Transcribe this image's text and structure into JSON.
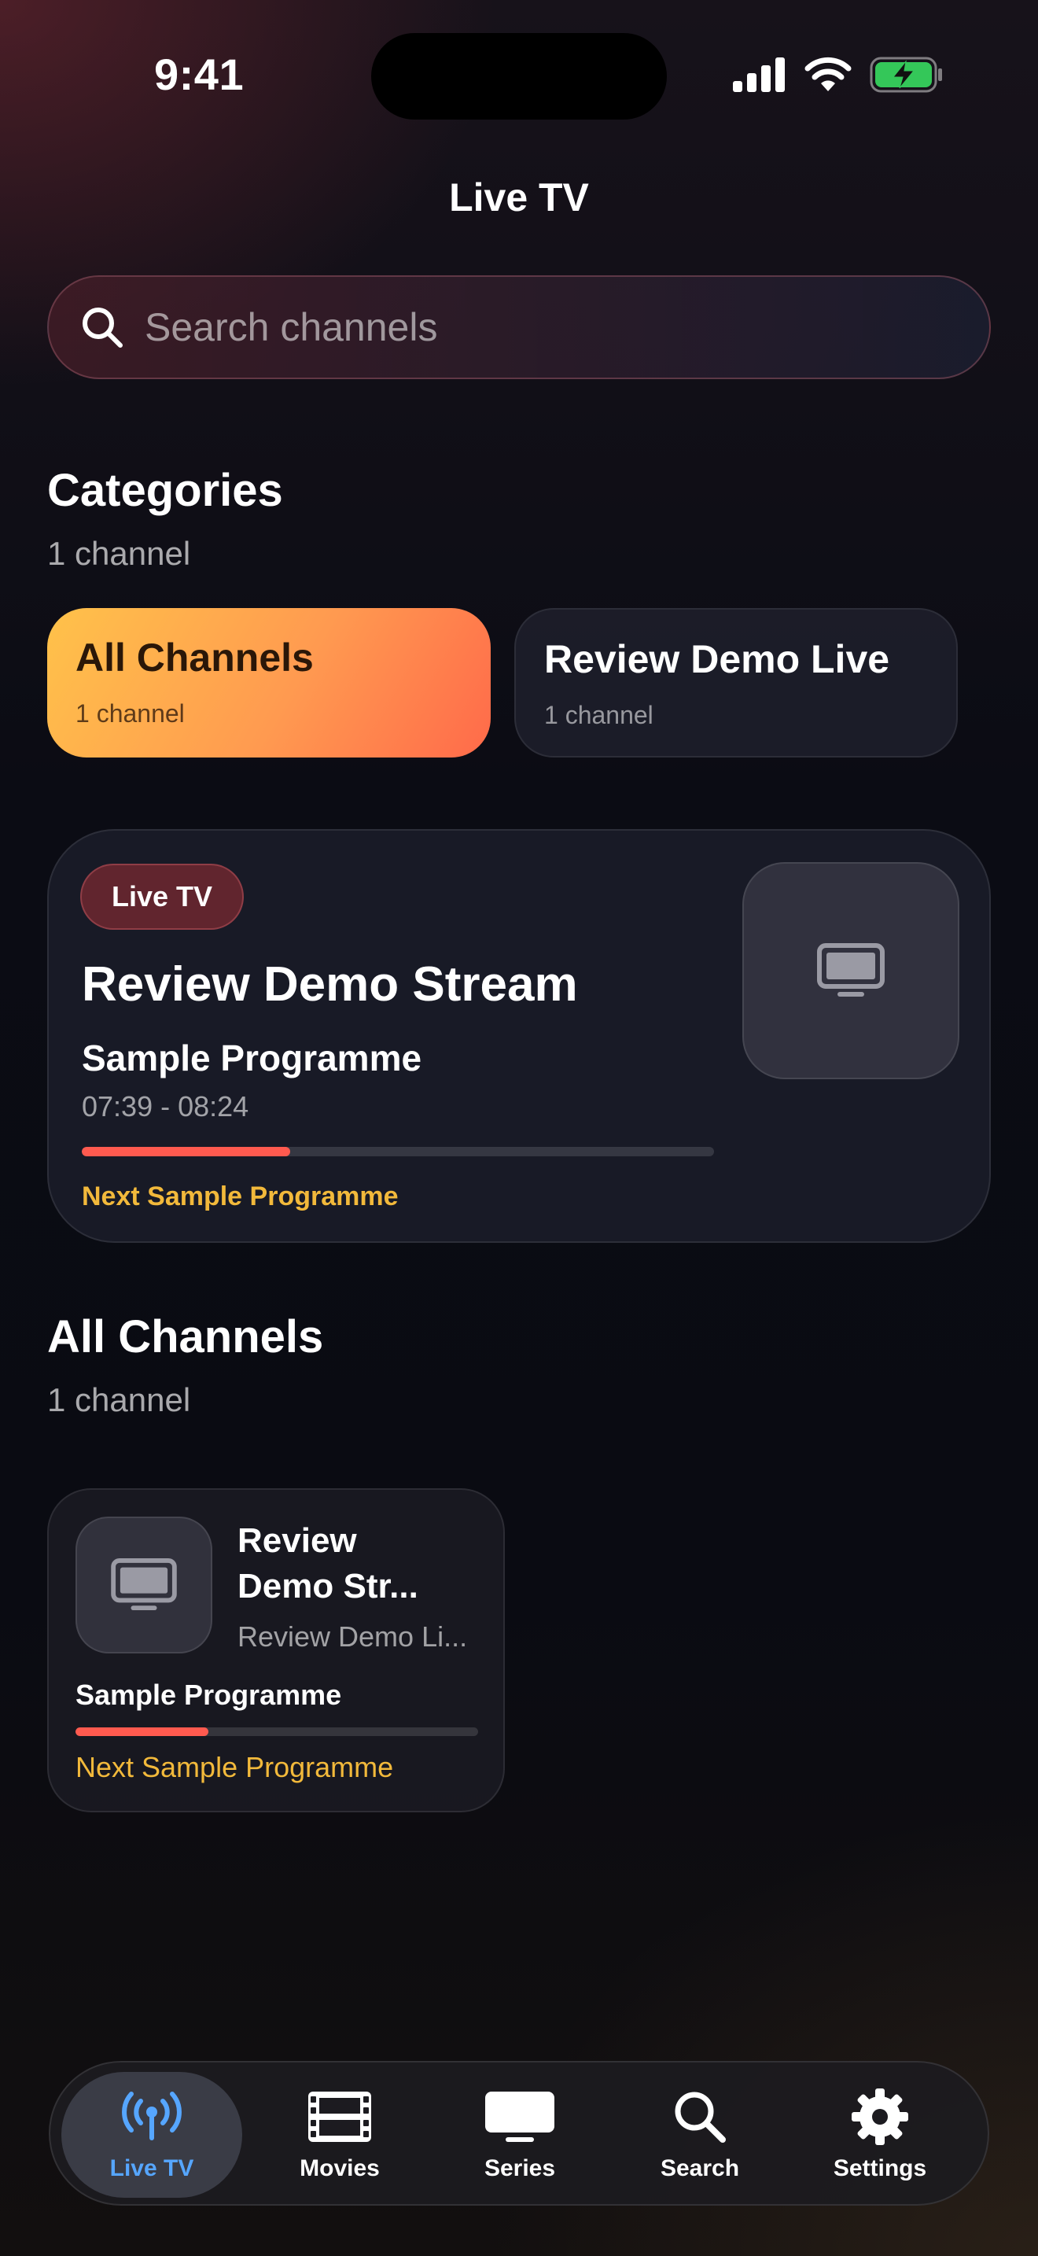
{
  "status_bar": {
    "time": "9:41",
    "icons": [
      "cellular-signal-icon",
      "wifi-icon",
      "battery-charging-icon"
    ]
  },
  "header": {
    "title": "Live TV"
  },
  "search": {
    "placeholder": "Search channels",
    "value": ""
  },
  "categories": {
    "title": "Categories",
    "subtitle": "1 channel",
    "items": [
      {
        "label": "All Channels",
        "count": "1 channel",
        "selected": true
      },
      {
        "label": "Review Demo Live",
        "count": "1 channel",
        "selected": false
      }
    ]
  },
  "featured": {
    "badge": "Live TV",
    "channel_name": "Review Demo Stream",
    "programme": "Sample Programme",
    "time_range": "07:39 - 08:24",
    "progress": 0.33,
    "next": "Next Sample Programme",
    "thumbnail_icon": "tv-icon"
  },
  "all_channels": {
    "title": "All Channels",
    "subtitle": "1 channel",
    "items": [
      {
        "name": "Review\nDemo Str...",
        "category": "Review Demo Li...",
        "programme": "Sample Programme",
        "progress": 0.33,
        "next": "Next Sample Programme",
        "thumbnail_icon": "tv-icon"
      }
    ]
  },
  "tab_bar": {
    "tabs": [
      {
        "label": "Live TV",
        "icon": "antenna-icon",
        "active": true
      },
      {
        "label": "Movies",
        "icon": "film-icon",
        "active": false
      },
      {
        "label": "Series",
        "icon": "tv-icon",
        "active": false
      },
      {
        "label": "Search",
        "icon": "search-icon",
        "active": false
      },
      {
        "label": "Settings",
        "icon": "gear-icon",
        "active": false
      }
    ]
  },
  "colors": {
    "accent_orange": "#ff9a50",
    "progress_red": "#ff5a4f",
    "next_yellow": "#f2b93b",
    "active_tab_blue": "#56a6ff"
  }
}
